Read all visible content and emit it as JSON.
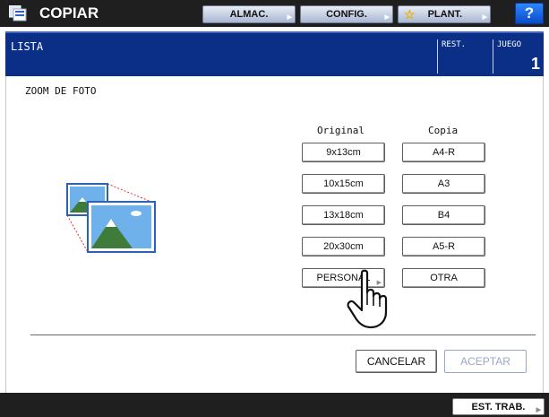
{
  "header": {
    "title": "COPIAR",
    "buttons": {
      "almac": "ALMAC.",
      "config": "CONFIG.",
      "plant": "PLANT."
    },
    "help": "?"
  },
  "status": {
    "title": "LISTA",
    "rest_label": "REST.",
    "juego_label": "JUEGO",
    "copies": "1"
  },
  "main": {
    "title": "ZOOM DE FOTO",
    "original_header": "Original",
    "copia_header": "Copia",
    "original_sizes": [
      "9x13cm",
      "10x15cm",
      "13x18cm",
      "20x30cm",
      "PERSONAL"
    ],
    "copia_sizes": [
      "A4-R",
      "A3",
      "B4",
      "A5-R",
      "OTRA"
    ],
    "cancel_label": "CANCELAR",
    "accept_label": "ACEPTAR"
  },
  "footer": {
    "job_status_label": "EST. TRAB."
  },
  "colors": {
    "topbar": "#1f1f1f",
    "statusbar": "#0b2f86",
    "help_button": "#1464f0"
  }
}
